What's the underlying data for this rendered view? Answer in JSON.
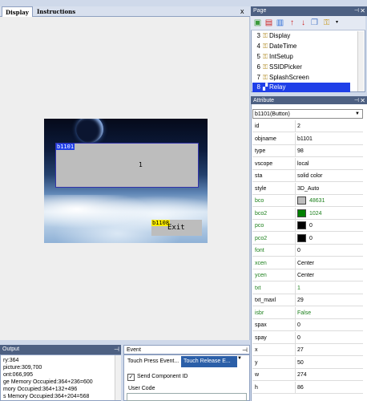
{
  "doc_tabs": {
    "display": "Display",
    "instructions": "Instructions",
    "close": "x"
  },
  "screen": {
    "b1101": {
      "label": "b1101",
      "text": "1"
    },
    "b1108": {
      "label": "b1108",
      "text": "Exit"
    }
  },
  "page_panel": {
    "title": "Page",
    "items": [
      {
        "num": "3",
        "name": "Display"
      },
      {
        "num": "4",
        "name": "DateTime"
      },
      {
        "num": "5",
        "name": "IntSetup"
      },
      {
        "num": "6",
        "name": "SSIDPicker"
      },
      {
        "num": "7",
        "name": "SplashScreen"
      },
      {
        "num": "8",
        "name": "Relay"
      }
    ]
  },
  "attribute_panel": {
    "title": "Attribute",
    "selected_object": "b1101(Button)",
    "rows": [
      {
        "key": "id",
        "value": "2"
      },
      {
        "key": "objname",
        "value": "b1101"
      },
      {
        "key": "type",
        "value": "98"
      },
      {
        "key": "vscope",
        "value": "local"
      },
      {
        "key": "sta",
        "value": "solid color"
      },
      {
        "key": "style",
        "value": "3D_Auto"
      },
      {
        "key": "bco",
        "value": "48631",
        "swatch": "#bdbdbd"
      },
      {
        "key": "bco2",
        "value": "1024",
        "swatch": "#008000"
      },
      {
        "key": "pco",
        "value": "0",
        "swatch": "#000000"
      },
      {
        "key": "pco2",
        "value": "0",
        "swatch": "#000000"
      },
      {
        "key": "font",
        "value": "0"
      },
      {
        "key": "xcen",
        "value": "Center"
      },
      {
        "key": "ycen",
        "value": "Center"
      },
      {
        "key": "txt",
        "value": "1"
      },
      {
        "key": "txt_maxl",
        "value": "29"
      },
      {
        "key": "isbr",
        "value": "False"
      },
      {
        "key": "spax",
        "value": "0"
      },
      {
        "key": "spay",
        "value": "0"
      },
      {
        "key": "x",
        "value": "27"
      },
      {
        "key": "y",
        "value": "50"
      },
      {
        "key": "w",
        "value": "274"
      },
      {
        "key": "h",
        "value": "86"
      }
    ]
  },
  "output_panel": {
    "title": "Output",
    "lines": [
      "ry:364",
      "picture:309,700",
      "ont:066,995",
      "ge Memory Occupied:364+236=600",
      "mory Occupied:364+132+496",
      "s Memory Occupied:364+204=568"
    ]
  },
  "event_panel": {
    "title": "Event",
    "tabs": [
      "Touch Press Event...",
      "Touch Release E..."
    ],
    "send_component_id": "Send Component ID",
    "user_code": "User Code"
  }
}
